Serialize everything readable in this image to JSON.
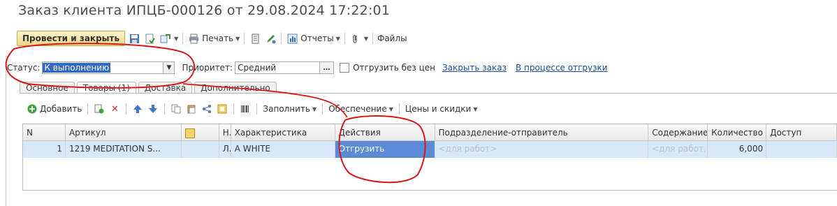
{
  "header": {
    "title": "Заказ клиента ИПЦБ-000126 от 29.08.2024 17:22:01"
  },
  "toolbar": {
    "post_close_label": "Провести и закрыть",
    "print_label": "Печать",
    "reports_label": "Отчеты",
    "files_label": "Файлы"
  },
  "status": {
    "label": "Статус:",
    "value": "К выполнению",
    "priority_label": "Приоритет:",
    "priority_value": "Средний",
    "checkbox_label": "Отгрузить без цен",
    "checkbox_checked": false,
    "close_order_link": "Закрыть заказ",
    "shipping_link": "В процессе отгрузки"
  },
  "tabs": [
    {
      "label": "Основное",
      "active": false
    },
    {
      "label": "Товары (1)",
      "active": true
    },
    {
      "label": "Доставка",
      "active": false
    },
    {
      "label": "Дополнительно",
      "active": false
    }
  ],
  "grid_toolbar": {
    "add_label": "Добавить",
    "fill_label": "Заполнить",
    "supply_label": "Обеспечение",
    "prices_label": "Цены и скидки"
  },
  "table": {
    "columns": [
      "N",
      "Артикул",
      "",
      "Н..",
      "Характеристика",
      "Действия",
      "Подразделение-отправитель",
      "Содержание",
      "Количество",
      "Доступ"
    ],
    "rows": [
      {
        "n": "1",
        "article": "1219 MEDITATION S...",
        "h": "Л..",
        "characteristic": "A WHITE",
        "action": "Отгрузить",
        "division": "<для работ>",
        "content": "<для работ, ...",
        "quantity": "6,000",
        "available": ""
      }
    ]
  },
  "colors": {
    "annotation": "#d81818",
    "selection": "#316ac5",
    "link": "#1a4fa0"
  }
}
